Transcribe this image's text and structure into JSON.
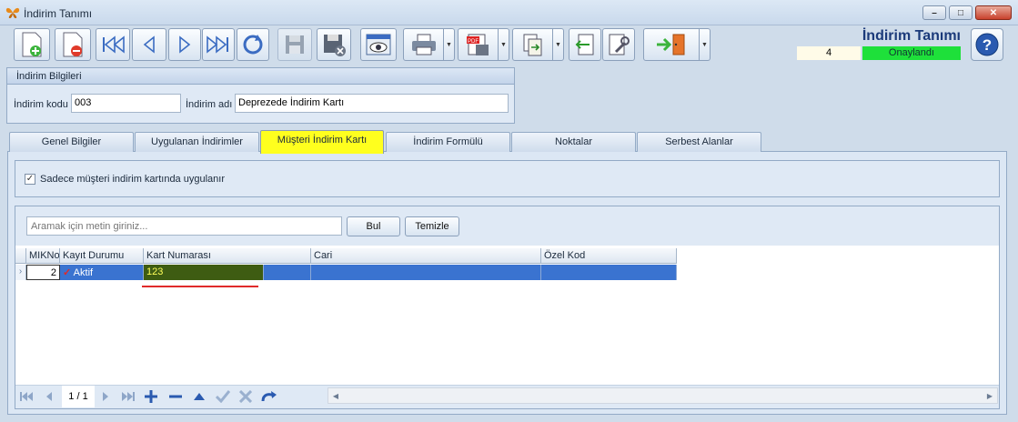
{
  "window": {
    "title": "İndirim Tanımı"
  },
  "header": {
    "doc_title": "İndirim Tanımı",
    "record_no": "4",
    "status": "Onaylandı",
    "status_color": "#1ee03a"
  },
  "toolbar": {
    "buttons": [
      "new-doc-icon",
      "delete-doc-icon",
      "first-record-icon",
      "prev-record-icon",
      "next-record-icon",
      "last-record-icon",
      "refresh-icon",
      "save-icon",
      "save-close-icon",
      "preview-icon",
      "print-icon",
      "pdf-export-icon",
      "export-icon",
      "import-icon",
      "settings-icon",
      "exit-icon",
      "help-icon"
    ]
  },
  "info_group": {
    "title": "İndirim Bilgileri",
    "code_label": "İndirim kodu",
    "code_value": "003",
    "name_label": "İndirim adı",
    "name_value": "Deprezede İndirim Kartı"
  },
  "tabs": [
    {
      "label": "Genel Bilgiler"
    },
    {
      "label": "Uygulanan İndirimler"
    },
    {
      "label": "Müşteri İndirim Kartı"
    },
    {
      "label": "İndirim Formülü"
    },
    {
      "label": "Noktalar"
    },
    {
      "label": "Serbest Alanlar"
    }
  ],
  "active_tab": "Müşteri İndirim Kartı",
  "option": {
    "label": "Sadece müşteri indirim kartında uygulanır",
    "checked": true
  },
  "search": {
    "placeholder": "Aramak için metin giriniz...",
    "find_label": "Bul",
    "clear_label": "Temizle"
  },
  "grid": {
    "columns": [
      "MIKNo",
      "Kayıt Durumu",
      "Kart Numarası",
      "Cari",
      "Özel Kod"
    ],
    "rows": [
      {
        "mikno": "2",
        "status": "Aktif",
        "card_no": "123",
        "cari": "",
        "ozel_kod": ""
      }
    ]
  },
  "navigator": {
    "page": "1 / 1"
  }
}
